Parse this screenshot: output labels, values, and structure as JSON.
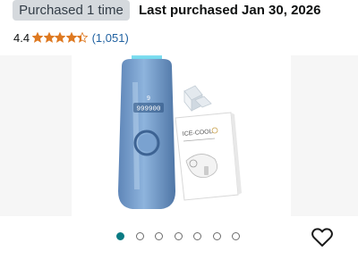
{
  "purchase": {
    "badge": "Purchased 1 time",
    "last_purchased": "Last purchased Jan 30, 2026"
  },
  "rating": {
    "value": "4.4",
    "stars": 4.4,
    "count": "(1,051)",
    "star_color": "#de7921",
    "link_color": "#2162a1"
  },
  "gallery": {
    "image_count": 7,
    "active_index": 0,
    "active_color": "#0a7b83",
    "box_text": "ICE-COOL",
    "device_display": "999900"
  },
  "icons": {
    "favorite": "heart-outline-icon",
    "star": "star-icon"
  }
}
